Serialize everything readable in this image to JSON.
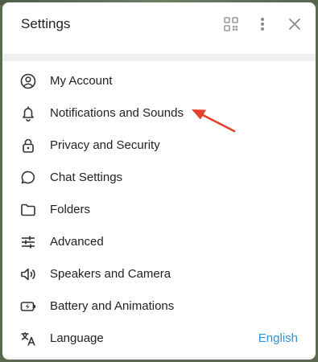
{
  "window": {
    "title": "Settings"
  },
  "header": {
    "icons": [
      "qr-code-icon",
      "more-vertical-icon",
      "close-icon"
    ]
  },
  "menu": {
    "items": [
      {
        "label": "My Account",
        "icon": "account-icon"
      },
      {
        "label": "Notifications and Sounds",
        "icon": "bell-icon"
      },
      {
        "label": "Privacy and Security",
        "icon": "lock-icon"
      },
      {
        "label": "Chat Settings",
        "icon": "chat-bubble-icon"
      },
      {
        "label": "Folders",
        "icon": "folder-icon"
      },
      {
        "label": "Advanced",
        "icon": "sliders-icon"
      },
      {
        "label": "Speakers and Camera",
        "icon": "speaker-icon"
      },
      {
        "label": "Battery and Animations",
        "icon": "battery-icon"
      },
      {
        "label": "Language",
        "icon": "language-icon",
        "value": "English"
      }
    ]
  },
  "colors": {
    "accent": "#3390d7",
    "annotation_arrow": "#e5402b"
  }
}
